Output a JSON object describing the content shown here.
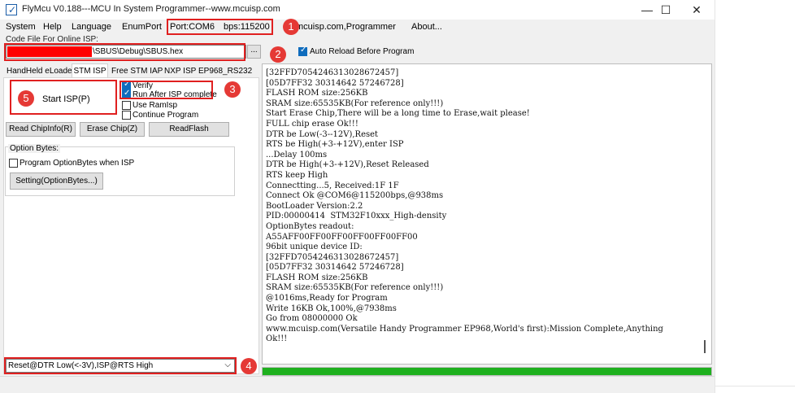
{
  "window": {
    "title": "FlyMcu V0.188---MCU In System Programmer--www.mcuisp.com",
    "controls": {
      "minimize": "—",
      "maximize": "☐",
      "close": "✕"
    }
  },
  "menu": {
    "system": "System",
    "help": "Help",
    "language": "Language",
    "enumport": "EnumPort",
    "port": "Port:COM6",
    "bps": "bps:115200",
    "site": "mcuisp.com,Programmer",
    "about": "About..."
  },
  "code_file": {
    "label": "Code File For Online ISP:",
    "path": "\\SBUS\\Debug\\SBUS.hex",
    "browse": "..."
  },
  "auto_reload": {
    "label": "Auto Reload Before Program",
    "checked": true
  },
  "tabs": [
    "HandHeld eLoader",
    "STM ISP",
    "Free STM IAP",
    "NXP ISP",
    "EP968_RS232"
  ],
  "isp": {
    "start": "Start ISP(P)",
    "options": [
      {
        "label": "Verify",
        "checked": true
      },
      {
        "label": "Run After ISP complete",
        "checked": true
      },
      {
        "label": "Use RamIsp",
        "checked": false
      },
      {
        "label": "Continue Program",
        "checked": false
      }
    ],
    "read_chipinfo": "Read ChipInfo(R)",
    "erase_chip": "Erase Chip(Z)",
    "read_flash": "ReadFlash"
  },
  "option_bytes": {
    "title": "Option Bytes:",
    "program_label": "Program OptionBytes when ISP",
    "program_checked": false,
    "setting": "Setting(OptionBytes...)"
  },
  "reset_mode": {
    "value": "Reset@DTR Low(<-3V),ISP@RTS High",
    "arrow": "⌵"
  },
  "badges": [
    "1",
    "2",
    "3",
    "4",
    "5"
  ],
  "log": [
    "[32FFD7054246313028672457]",
    "[05D7FF32 30314642 57246728]",
    "FLASH ROM size:256KB",
    "SRAM size:65535KB(For reference only!!!)",
    "Start Erase Chip,There will be a long time to Erase,wait please!",
    "FULL chip erase Ok!!!",
    "DTR be Low(-3--12V),Reset",
    "RTS be High(+3-+12V),enter ISP",
    "...Delay 100ms",
    "DTR be High(+3-+12V),Reset Released",
    "RTS keep High",
    "Connectting...5, Received:1F 1F",
    "Connect Ok @COM6@115200bps,@938ms",
    "BootLoader Version:2.2",
    "PID:00000414  STM32F10xxx_High-density",
    "OptionBytes readout:",
    "A55AFF00FF00FF00FF00FF00FF00",
    "96bit unique device ID:",
    "[32FFD7054246313028672457]",
    "[05D7FF32 30314642 57246728]",
    "FLASH ROM size:256KB",
    "SRAM size:65535KB(For reference only!!!)",
    "@1016ms,Ready for Program",
    "Write 16KB Ok,100%,@7938ms",
    "Go from 08000000 Ok",
    "www.mcuisp.com(Versatile Handy Programmer EP968,World's first):Mission Complete,Anything",
    "Ok!!!"
  ],
  "progress": {
    "percent": 100,
    "color": "#1eb01e"
  },
  "colors": {
    "annotation": "#e02020",
    "badge": "#e53935",
    "accent": "#0f6cbd"
  }
}
